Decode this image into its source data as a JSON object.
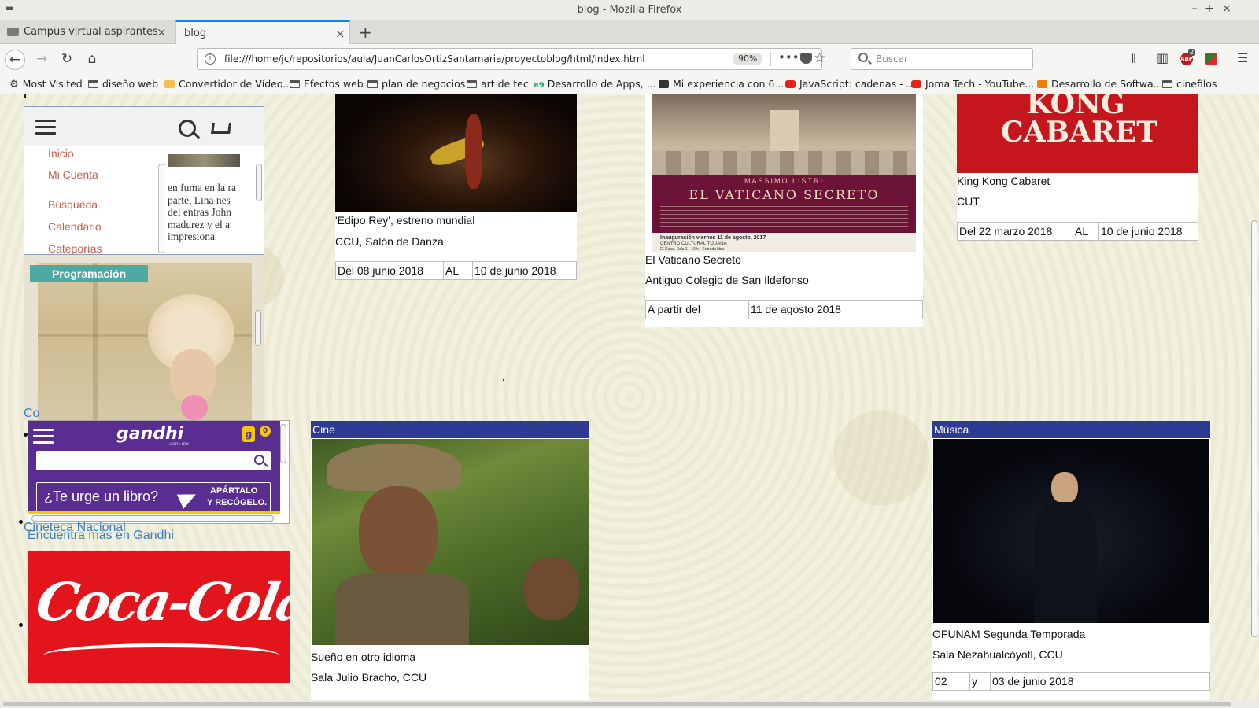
{
  "window": {
    "title": "blog - Mozilla Firefox",
    "minimize": "–",
    "maximize": "+",
    "close": "×"
  },
  "tabs": [
    {
      "label": "Campus virtual aspirantes",
      "close": "×",
      "active": false
    },
    {
      "label": "blog",
      "close": "×",
      "active": true
    }
  ],
  "new_tab": "+",
  "nav": {
    "back": "←",
    "forward": "→",
    "reload": "↻",
    "home": "⌂",
    "url": "file:///home/jc/repositorios/aula/JuanCarlosOrtizSantamaria/proyectoblog/html/index.html",
    "zoom": "90%",
    "more": "•••",
    "bookmark_star": "☆",
    "search_placeholder": "Buscar",
    "library": "𝍪",
    "sidebar": "▥",
    "adblock_badge": "2",
    "menu": "☰"
  },
  "bookmarks": [
    {
      "label": "Most Visited",
      "icon": "gear-icon"
    },
    {
      "label": "diseño web",
      "icon": "folder-icon"
    },
    {
      "label": "Convertidor de Vídeo...",
      "icon": "cat-icon"
    },
    {
      "label": "Efectos web",
      "icon": "folder-icon"
    },
    {
      "label": "plan de negocios",
      "icon": "folder-icon"
    },
    {
      "label": "art de tec",
      "icon": "folder-icon"
    },
    {
      "label": "Desarrollo de Apps, ...",
      "icon": "e9-icon"
    },
    {
      "label": "Mi experiencia con 6 ...",
      "icon": "square-icon"
    },
    {
      "label": "JavaScript: cadenas - ...",
      "icon": "youtube-icon"
    },
    {
      "label": "Joma Tech - YouTube...",
      "icon": "youtube-icon"
    },
    {
      "label": "Desarrollo de Softwa...",
      "icon": "blogger-icon"
    },
    {
      "label": "cinefilos",
      "icon": "folder-icon"
    }
  ],
  "sidebar_menu": {
    "items": [
      "Inicio",
      "Mi Cuenta",
      "Búsqueda",
      "Calendario",
      "Categorías"
    ],
    "article_text": "en fuma en la ra parte, Lina nes del entras John madurez y el a impresiona"
  },
  "programacion_badge": "Programación",
  "cut_link": "Co",
  "gandhi": {
    "logo": "gandhi",
    "logo_sub": ".com.mx",
    "bag": "g",
    "cart_count": "0",
    "banner_question": "¿Te urge un libro?",
    "banner_cta_1": "APÁRTALO",
    "banner_cta_2": "Y RECÓGELO."
  },
  "links": {
    "cineteca": "Cineteca Nacional",
    "gandhi_more": "Encuentra más en Gandhi"
  },
  "coca_cola": "Coca-Cola",
  "events": [
    {
      "title": "'Edipo Rey', estreno mundial",
      "venue": "CCU, Salón de Danza",
      "dates": [
        "Del 08 junio 2018",
        "AL",
        "10 de junio 2018"
      ]
    },
    {
      "title": "El Vaticano Secreto",
      "venue": "Antiguo Colegio de San Ildefonso",
      "dates": [
        "A partir del",
        "11 de agosto 2018"
      ],
      "poster": {
        "artist": "MASSIMO LISTRI",
        "headline": "EL VATICANO SECRETO",
        "inauguration": "Inauguración viernes 11 de agosto, 2017",
        "center": "CENTRO CULTURAL TIJUANA",
        "room": "El Cubo, Sala 1 · 19 h · Entrada libre"
      }
    },
    {
      "title": "King Kong Cabaret",
      "venue": "CUT",
      "dates": [
        "Del 22 marzo 2018",
        "AL",
        "10 de junio 2018"
      ],
      "poster_text": "KONG CABARET"
    },
    {
      "category": "Cine",
      "title": "Sueño en otro idioma",
      "venue": "Sala Julio Bracho, CCU"
    },
    {
      "category": "Música",
      "title": "OFUNAM Segunda Temporada",
      "venue": "Sala Nezahualcóyotl, CCU",
      "dates": [
        "02",
        "y",
        "03 de junio 2018"
      ]
    }
  ],
  "colors": {
    "page_background": "#f2f0de",
    "category_header": "#2e3b93",
    "menu_link": "#d15b45",
    "link_blue": "#3d7fc0",
    "gandhi_purple": "#5a2d91",
    "gandhi_yellow": "#f6c800",
    "coke_red": "#e3151c",
    "programacion_teal": "#4fa9a3",
    "tab_accent": "#0a84ff"
  }
}
